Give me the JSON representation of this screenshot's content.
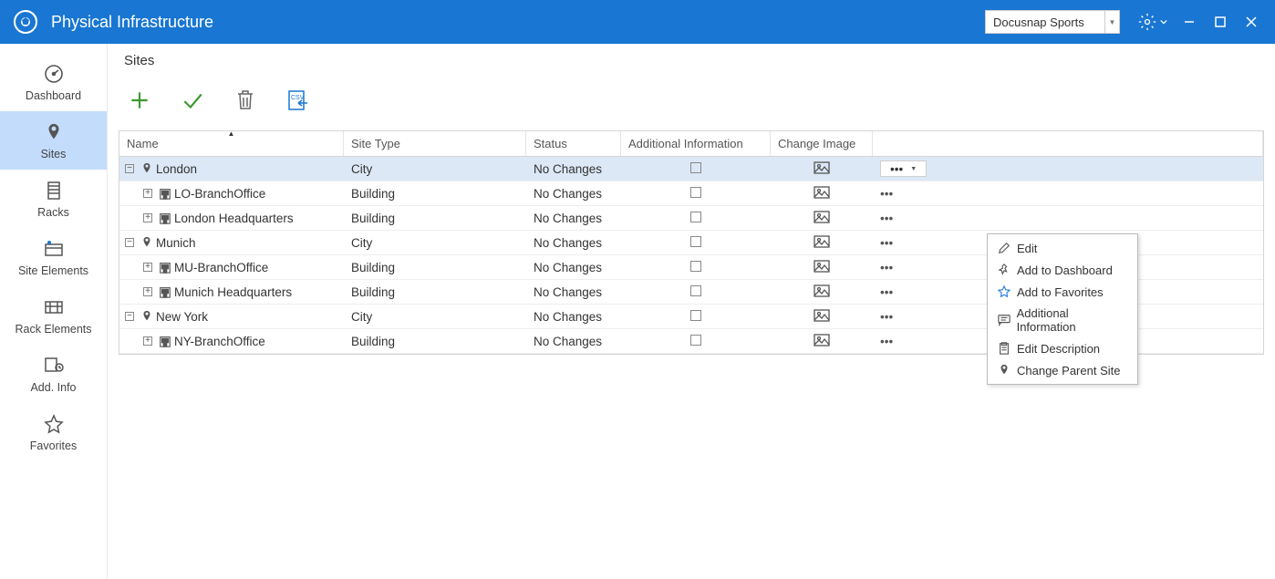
{
  "app": {
    "title": "Physical Infrastructure",
    "tenant": "Docusnap Sports"
  },
  "sidebar": {
    "items": [
      {
        "label": "Dashboard"
      },
      {
        "label": "Sites"
      },
      {
        "label": "Racks"
      },
      {
        "label": "Site Elements"
      },
      {
        "label": "Rack Elements"
      },
      {
        "label": "Add. Info"
      },
      {
        "label": "Favorites"
      }
    ],
    "active_index": 1
  },
  "page": {
    "title": "Sites"
  },
  "grid": {
    "columns": {
      "name": "Name",
      "type": "Site Type",
      "status": "Status",
      "addl": "Additional Information",
      "cimg": "Change Image"
    },
    "rows": [
      {
        "indent": 0,
        "expand": "-",
        "icon": "pin",
        "name": "London",
        "type": "City",
        "status": "No Changes",
        "selected": true,
        "dots_open": true
      },
      {
        "indent": 1,
        "expand": "+",
        "icon": "building",
        "name": "LO-BranchOffice",
        "type": "Building",
        "status": "No Changes"
      },
      {
        "indent": 1,
        "expand": "+",
        "icon": "building",
        "name": "London Headquarters",
        "type": "Building",
        "status": "No Changes"
      },
      {
        "indent": 0,
        "expand": "-",
        "icon": "pin",
        "name": "Munich",
        "type": "City",
        "status": "No Changes"
      },
      {
        "indent": 1,
        "expand": "+",
        "icon": "building",
        "name": "MU-BranchOffice",
        "type": "Building",
        "status": "No Changes"
      },
      {
        "indent": 1,
        "expand": "+",
        "icon": "building",
        "name": "Munich Headquarters",
        "type": "Building",
        "status": "No Changes"
      },
      {
        "indent": 0,
        "expand": "-",
        "icon": "pin",
        "name": "New York",
        "type": "City",
        "status": "No Changes"
      },
      {
        "indent": 1,
        "expand": "+",
        "icon": "building",
        "name": "NY-BranchOffice",
        "type": "Building",
        "status": "No Changes"
      }
    ]
  },
  "context_menu": {
    "items": [
      {
        "label": "Edit"
      },
      {
        "label": "Add to Dashboard"
      },
      {
        "label": "Add to Favorites"
      },
      {
        "label": "Additional Information"
      },
      {
        "label": "Edit Description"
      },
      {
        "label": "Change Parent Site"
      }
    ]
  }
}
